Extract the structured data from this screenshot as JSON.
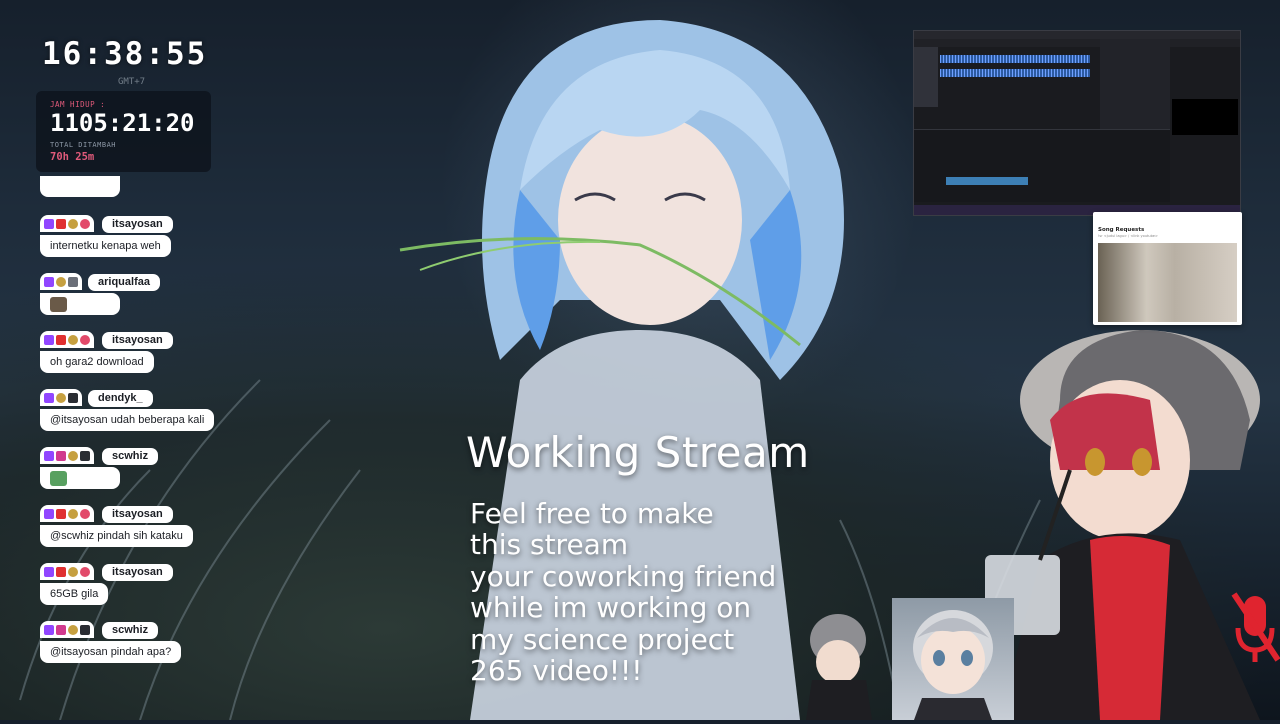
{
  "clock": {
    "time": "16:38:55",
    "sub": "GMT+7"
  },
  "subathon": {
    "label": "JAM HIDUP :",
    "time_left": "1105:21:20",
    "added_label": "TOTAL DITAMBAH",
    "added_value": "70h 25m"
  },
  "chat": {
    "messages": [
      {
        "user": "itsayosan",
        "text": "internetku kenapa weh",
        "badges": [
          "twitch",
          "red",
          "star",
          "heart"
        ]
      },
      {
        "user": "ariqualfaa",
        "text": "",
        "emote": true,
        "badges": [
          "twitch",
          "star",
          "gray"
        ]
      },
      {
        "user": "itsayosan",
        "text": "oh gara2 download",
        "badges": [
          "twitch",
          "red",
          "star",
          "heart"
        ]
      },
      {
        "user": "dendyk_",
        "text": "@itsayosan udah beberapa kali",
        "badges": [
          "twitch",
          "star",
          "dark"
        ]
      },
      {
        "user": "scwhiz",
        "text": "",
        "emote": true,
        "badges": [
          "twitch",
          "pink",
          "star",
          "dark"
        ]
      },
      {
        "user": "itsayosan",
        "text": "@scwhiz pindah sih kataku",
        "badges": [
          "twitch",
          "red",
          "star",
          "heart"
        ]
      },
      {
        "user": "itsayosan",
        "text": "65GB gila",
        "badges": [
          "twitch",
          "red",
          "star",
          "heart"
        ]
      },
      {
        "user": "scwhiz",
        "text": "@itsayosan pindah apa?",
        "badges": [
          "twitch",
          "pink",
          "star",
          "dark"
        ]
      }
    ]
  },
  "overlay": {
    "title": "Working Stream",
    "description": [
      "Feel free to make",
      "this stream",
      "your coworking friend",
      "while im working on",
      "my science project",
      "265 video!!!"
    ]
  },
  "song_requests": {
    "title": "Song Requests",
    "subtitle": "!sr <judul lagu> / <link youtube>"
  },
  "icons": {
    "mic_muted": "mic-off-icon",
    "twitch": "twitch-badge-icon"
  },
  "colors": {
    "accent": "#e05a7a",
    "twitch": "#9146ff",
    "mic_off": "#e0242f"
  }
}
